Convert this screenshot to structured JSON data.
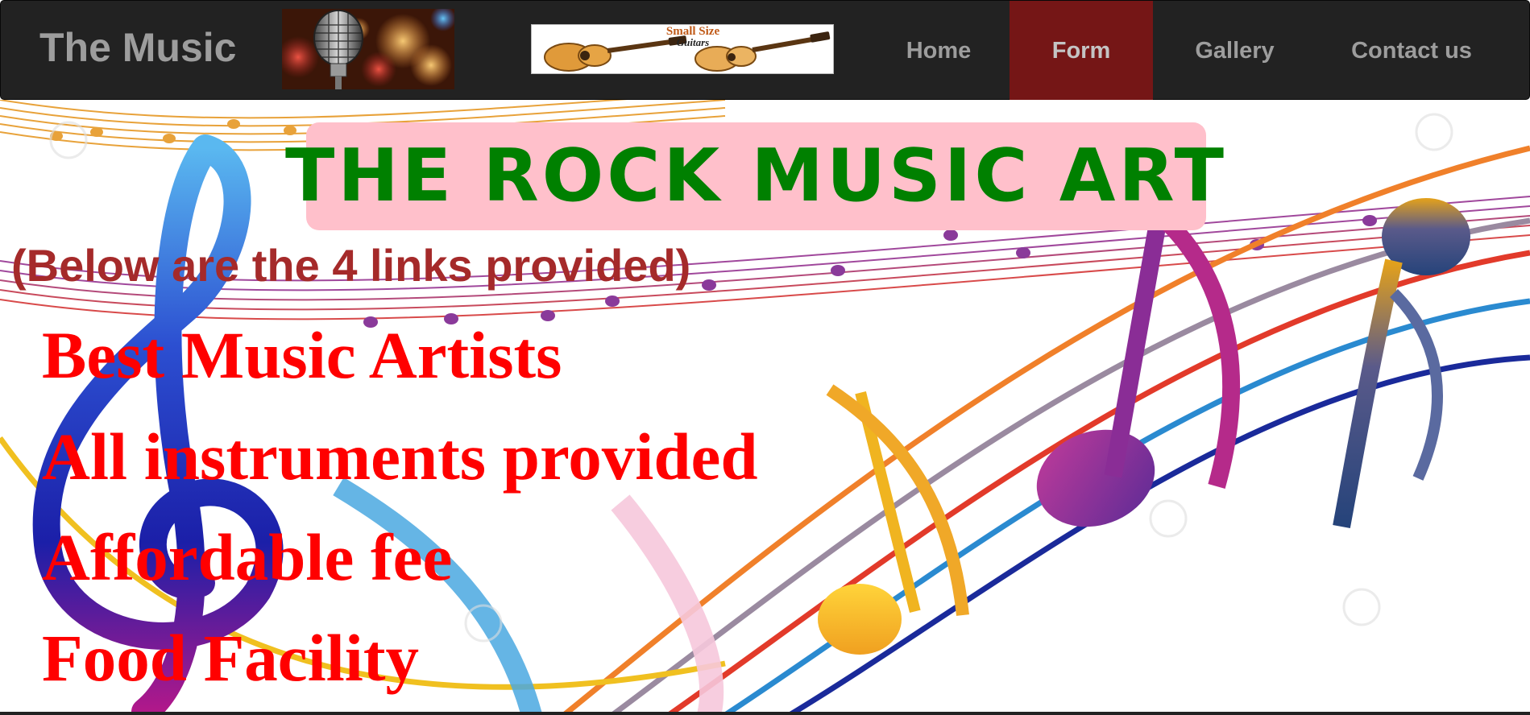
{
  "navbar": {
    "brand": "The Music",
    "banner": {
      "title": "Small Size",
      "subtitle": "Guitars"
    },
    "links": [
      {
        "label": "Home",
        "active": false
      },
      {
        "label": "Form",
        "active": true
      },
      {
        "label": "Gallery",
        "active": false
      },
      {
        "label": "Contact us",
        "active": false
      }
    ],
    "colors": {
      "background": "#222222",
      "link_text": "#9d9d9d",
      "active_background": "#751616"
    }
  },
  "hero": {
    "title": "THE ROCK MUSIC ART",
    "intro": "(Below are the 4 links provided)",
    "features": [
      "Best Music Artists",
      "All instruments provided",
      "Affordable fee",
      "Food Facility"
    ],
    "background_art": "colorful-music-notes-staff-illustration",
    "colors": {
      "title_box": "#ffc0cb",
      "title_text": "#008000",
      "intro_text": "#a52a2a",
      "feature_text": "#ff0000"
    }
  }
}
